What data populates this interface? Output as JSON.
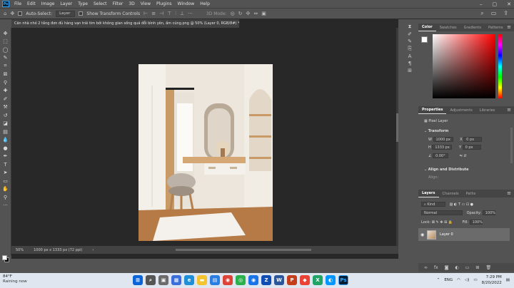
{
  "menu": [
    "File",
    "Edit",
    "Image",
    "Layer",
    "Type",
    "Select",
    "Filter",
    "3D",
    "View",
    "Plugins",
    "Window",
    "Help"
  ],
  "options": {
    "auto_select": "Auto-Select:",
    "layer_select": "Layer",
    "show_transform": "Show Transform Controls",
    "mode_3d": "3D Mode:"
  },
  "document": {
    "tab_title": "Căn nhà nhỏ 2 tầng đơn đủ hàng vạn trái tim bởi không gian sống quá đỗi bình yên, ấm cúng.png @ 50% (Layer 0, RGB/8#) *",
    "zoom": "50%",
    "size_info": "1000 px x 1333 px (72 ppi)"
  },
  "color_panel": {
    "tabs": [
      "Color",
      "Swatches",
      "Gradients",
      "Patterns"
    ]
  },
  "properties_panel": {
    "tabs": [
      "Properties",
      "Adjustments",
      "Libraries"
    ],
    "pixel_layer": "Pixel Layer",
    "transform": "Transform",
    "w_label": "W",
    "w_value": "1000 px",
    "h_label": "H",
    "h_value": "1333 px",
    "x_label": "X",
    "x_value": "0 px",
    "y_label": "Y",
    "y_value": "0 px",
    "angle": "0.00°",
    "align": "Align and Distribute",
    "align_sub": "Align:"
  },
  "layers_panel": {
    "tabs": [
      "Layers",
      "Channels",
      "Paths"
    ],
    "kind": "Kind",
    "blend": "Normal",
    "opacity_label": "Opacity:",
    "opacity": "100%",
    "lock_label": "Lock:",
    "fill_label": "Fill:",
    "fill": "100%",
    "layer_name": "Layer 0"
  },
  "taskbar": {
    "temp": "84°F",
    "weather": "Raining now",
    "lang": "ENG",
    "time": "7:29 PM",
    "date": "8/20/2022"
  },
  "colors": {
    "accent": "#31a8ff",
    "panel_bg": "#535353",
    "canvas_bg": "#282828"
  }
}
